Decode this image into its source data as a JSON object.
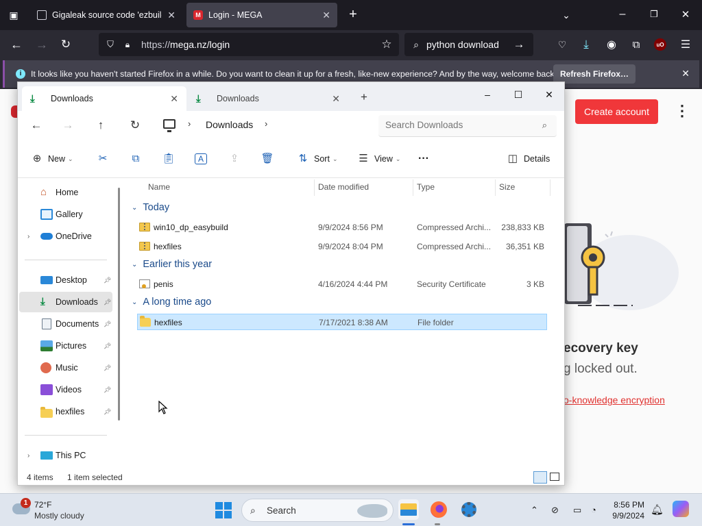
{
  "browser": {
    "tabs": [
      {
        "title": "Gigaleak source code 'ezbuild",
        "favicon": "notebook-icon"
      },
      {
        "title": "Login - MEGA",
        "favicon": "mega-icon",
        "favicon_letter": "M"
      }
    ],
    "url_scheme": "https://",
    "url_host": "mega.nz/login",
    "search_text": "python download",
    "notification": {
      "message": "It looks like you haven't started Firefox in a while. Do you want to clean it up for a fresh, like-new experience? And by the way, welcome back!",
      "button": "Refresh Firefox…",
      "info_glyph": "i"
    }
  },
  "mega": {
    "create_account": "Create account",
    "heading": "ecovery key",
    "subheading": "g locked out.",
    "link": "o-knowledge encryption"
  },
  "explorer": {
    "tabs": [
      {
        "title": "Downloads"
      },
      {
        "title": "Downloads"
      }
    ],
    "breadcrumb": "Downloads",
    "search_placeholder": "Search Downloads",
    "commands": {
      "new": "New",
      "sort": "Sort",
      "view": "View",
      "more": "···",
      "details": "Details"
    },
    "sidebar": [
      {
        "label": "Home",
        "icon": "home-icon"
      },
      {
        "label": "Gallery",
        "icon": "gallery-icon"
      },
      {
        "label": "OneDrive",
        "icon": "onedrive-icon"
      },
      {
        "label": "Desktop",
        "icon": "desktop-icon"
      },
      {
        "label": "Downloads",
        "icon": "download-icon"
      },
      {
        "label": "Documents",
        "icon": "documents-icon"
      },
      {
        "label": "Pictures",
        "icon": "pictures-icon"
      },
      {
        "label": "Music",
        "icon": "music-icon"
      },
      {
        "label": "Videos",
        "icon": "videos-icon"
      },
      {
        "label": "hexfiles",
        "icon": "folder-icon"
      },
      {
        "label": "This PC",
        "icon": "this-pc-icon"
      }
    ],
    "columns": {
      "name": "Name",
      "date": "Date modified",
      "type": "Type",
      "size": "Size"
    },
    "groups": [
      {
        "label": "Today",
        "files": [
          {
            "name": "win10_dp_easybuild",
            "date": "9/9/2024 8:56 PM",
            "type": "Compressed Archi...",
            "size": "238,833 KB",
            "icon": "zip-icon"
          },
          {
            "name": "hexfiles",
            "date": "9/9/2024 8:04 PM",
            "type": "Compressed Archi...",
            "size": "36,351 KB",
            "icon": "zip-icon"
          }
        ]
      },
      {
        "label": "Earlier this year",
        "files": [
          {
            "name": "penis",
            "date": "4/16/2024 4:44 PM",
            "type": "Security Certificate",
            "size": "3 KB",
            "icon": "certificate-icon"
          }
        ]
      },
      {
        "label": "A long time ago",
        "files": [
          {
            "name": "hexfiles",
            "date": "7/17/2021 8:38 AM",
            "type": "File folder",
            "size": "",
            "icon": "folder-icon",
            "selected": true
          }
        ]
      }
    ],
    "status": {
      "count": "4 items",
      "selected": "1 item selected"
    }
  },
  "taskbar": {
    "weather": {
      "temp": "72°F",
      "condition": "Mostly cloudy",
      "badge": "1"
    },
    "search": "Search",
    "time": "8:56 PM",
    "date": "9/9/2024"
  },
  "colors": {
    "mega_red": "#f0373a",
    "selection": "#cce8ff",
    "group_header": "#1a4a8a",
    "download_green": "#0b8a43"
  }
}
